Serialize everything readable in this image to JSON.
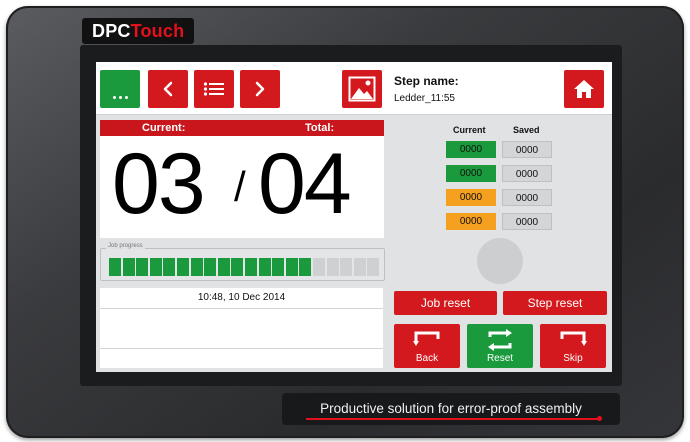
{
  "brand": {
    "part1": "DPC",
    "part2": "Touch"
  },
  "tagline": "Productive solution for error-proof assembly",
  "header": {
    "step_label": "Step name:",
    "step_value": "Ledder_11:55",
    "more_icon": "ellipsis-icon",
    "prev_icon": "chevron-left-icon",
    "list_icon": "list-icon",
    "next_icon": "chevron-right-icon",
    "image_icon": "image-icon",
    "home_icon": "home-icon"
  },
  "counter": {
    "current_label": "Current:",
    "total_label": "Total:",
    "current_value": "03",
    "separator": "/",
    "total_value": "04"
  },
  "progress": {
    "label": "Job progress",
    "filled_segments": 15,
    "total_segments": 20,
    "fill_color": "#1a9a3c",
    "empty_color": "#cfd0d2"
  },
  "log": {
    "timestamp": "10:48, 10 Dec 2014"
  },
  "values_table": {
    "current_header": "Current",
    "saved_header": "Saved",
    "rows": [
      {
        "current": "0000",
        "saved": "0000",
        "status": "green"
      },
      {
        "current": "0000",
        "saved": "0000",
        "status": "green"
      },
      {
        "current": "0000",
        "saved": "0000",
        "status": "orange"
      },
      {
        "current": "0000",
        "saved": "0000",
        "status": "orange"
      }
    ]
  },
  "actions": {
    "job_reset": "Job reset",
    "step_reset": "Step reset",
    "back": "Back",
    "reset": "Reset",
    "skip": "Skip"
  },
  "colors": {
    "accent_red": "#d3191e",
    "accent_green": "#1a9a3c",
    "warning_orange": "#f5a01e"
  }
}
